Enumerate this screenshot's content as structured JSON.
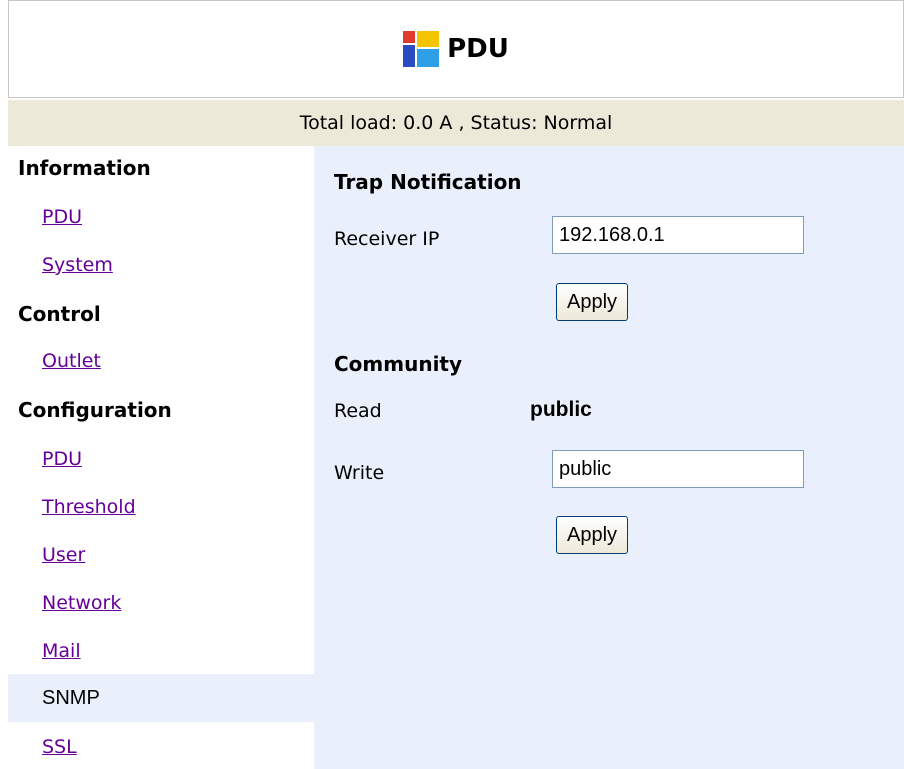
{
  "header": {
    "title": "PDU",
    "logo_icon": "pdu-logo-icon"
  },
  "status": {
    "text": "Total load: 0.0 A , Status: Normal"
  },
  "sidebar": {
    "information": "Information",
    "info_items": [
      "PDU",
      "System"
    ],
    "control": "Control",
    "control_items": [
      "Outlet"
    ],
    "configuration": "Configuration",
    "config_items": [
      "PDU",
      "Threshold",
      "User",
      "Network",
      "Mail"
    ],
    "active_item": "SNMP",
    "after_active": [
      "SSL"
    ]
  },
  "main": {
    "trap_heading": "Trap Notification",
    "receiver_label": "Receiver IP",
    "receiver_value": "192.168.0.1",
    "apply_label": "Apply",
    "community_heading": "Community",
    "read_label": "Read",
    "read_value": "public",
    "write_label": "Write",
    "write_value": "public"
  },
  "colors": {
    "accent_link": "#660099",
    "status_bg": "#ece9d8",
    "content_bg": "#e9effb"
  }
}
